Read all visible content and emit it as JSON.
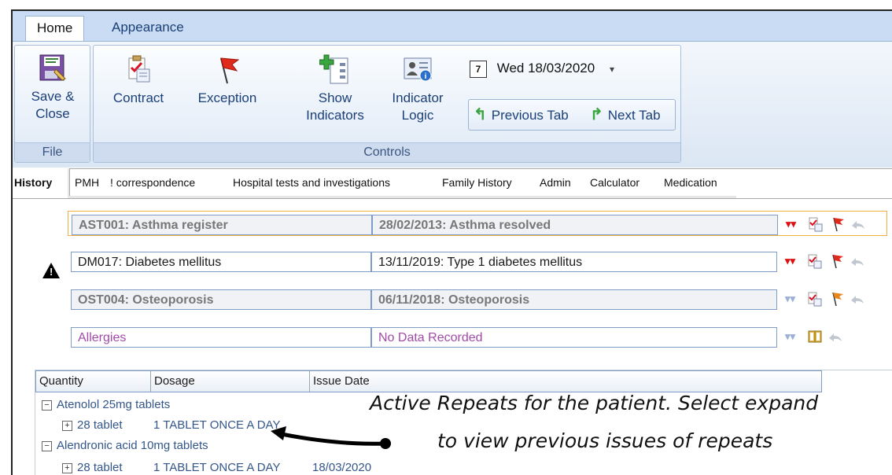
{
  "ribbon": {
    "tabs": [
      "Home",
      "Appearance"
    ],
    "file_group": {
      "label": "File",
      "save_close": [
        "Save &",
        "Close"
      ]
    },
    "controls_group": {
      "label": "Controls",
      "contract": "Contract",
      "exception": "Exception",
      "show_indicators": [
        "Show",
        "Indicators"
      ],
      "indicator_logic": [
        "Indicator",
        "Logic"
      ],
      "date": "Wed 18/03/2020",
      "previous_tab": "Previous Tab",
      "next_tab": "Next Tab"
    }
  },
  "record_tabs": [
    "History",
    "PMH",
    "! correspondence",
    "Hospital tests and investigations",
    "Family History",
    "Admin",
    "Calculator",
    "Medication"
  ],
  "pmh_rows": [
    {
      "indicator": "AST001: Asthma register",
      "detail": "28/02/2013: Asthma resolved"
    },
    {
      "indicator": "DM017: Diabetes mellitus",
      "detail": "13/11/2019: Type 1 diabetes mellitus"
    },
    {
      "indicator": "OST004: Osteoporosis",
      "detail": "06/11/2018: Osteoporosis"
    },
    {
      "indicator": "Allergies",
      "detail": "No Data Recorded"
    }
  ],
  "grid": {
    "headers": [
      "Quantity",
      "Dosage",
      "Issue Date"
    ],
    "drugs": [
      {
        "name": "Atenolol 25mg tablets",
        "qty": "28 tablet",
        "dosage": "1 TABLET ONCE A DAY",
        "date": ""
      },
      {
        "name": "Alendronic acid 10mg tablets",
        "qty": "28 tablet",
        "dosage": "1 TABLET ONCE A DAY",
        "date": "18/03/2020"
      }
    ]
  },
  "annotation": [
    "Active Repeats for the patient. Select expand",
    "to view previous issues of repeats"
  ],
  "colors": {
    "ribbon": "#c9dcf3",
    "accent_text": "#1b3f77",
    "allergy_text": "#a24aa8",
    "flag_red": "#d11"
  }
}
